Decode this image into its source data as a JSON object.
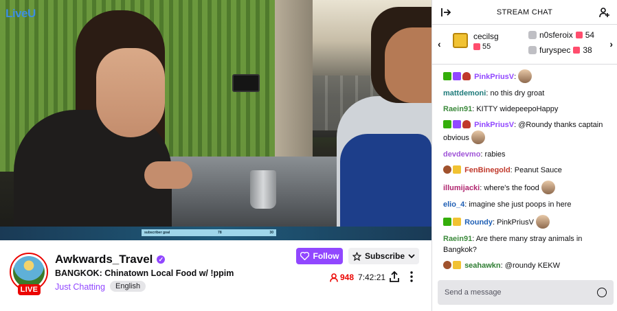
{
  "video": {
    "logo": "LiveU",
    "goal_bar": {
      "label": "subscriber goal",
      "current": "78",
      "target": "30"
    }
  },
  "channel": {
    "name": "Awkwards_Travel",
    "stream_title": "BANGKOK: Chinatown Local Food w/ !ppim",
    "category": "Just Chatting",
    "tag": "English",
    "live_label": "LIVE",
    "viewers": "948",
    "uptime": "7:42:21",
    "follow_label": "Follow",
    "subscribe_label": "Subscribe"
  },
  "chat": {
    "title": "STREAM CHAT",
    "gifters": {
      "top": {
        "name": "cecilsg",
        "count": "55"
      },
      "others": [
        {
          "name": "n0sferoix",
          "count": "54"
        },
        {
          "name": "furyspec",
          "count": "38"
        }
      ]
    },
    "messages": [
      {
        "user": "PinkPriusV",
        "color": "#9147ff",
        "text": ""
      },
      {
        "user": "mattdemoni",
        "color": "#1e7a7a",
        "text": "no this dry groat"
      },
      {
        "user": "Raein91",
        "color": "#3c8a3c",
        "text": "KITTY widepeepoHappy"
      },
      {
        "user": "PinkPriusV",
        "color": "#9147ff",
        "text": "@Roundy thanks captain obvious"
      },
      {
        "user": "devdevmo",
        "color": "#a055d8",
        "text": "rabies"
      },
      {
        "user": "FenBinegold",
        "color": "#c0392b",
        "text": "Peanut Sauce"
      },
      {
        "user": "illumijacki",
        "color": "#b0256e",
        "text": "where's the food"
      },
      {
        "user": "elio_4",
        "color": "#1f5fb5",
        "text": "imagine she just poops in here"
      },
      {
        "user": "Roundy",
        "color": "#1f5fb5",
        "text": "PinkPriusV"
      },
      {
        "user": "Raein91",
        "color": "#3c8a3c",
        "text": "Are there many stray animals in Bangkok?"
      },
      {
        "user": "seahawkn",
        "color": "#2e7d32",
        "text": "@roundy KEKW"
      }
    ],
    "input_placeholder": "Send a message"
  }
}
